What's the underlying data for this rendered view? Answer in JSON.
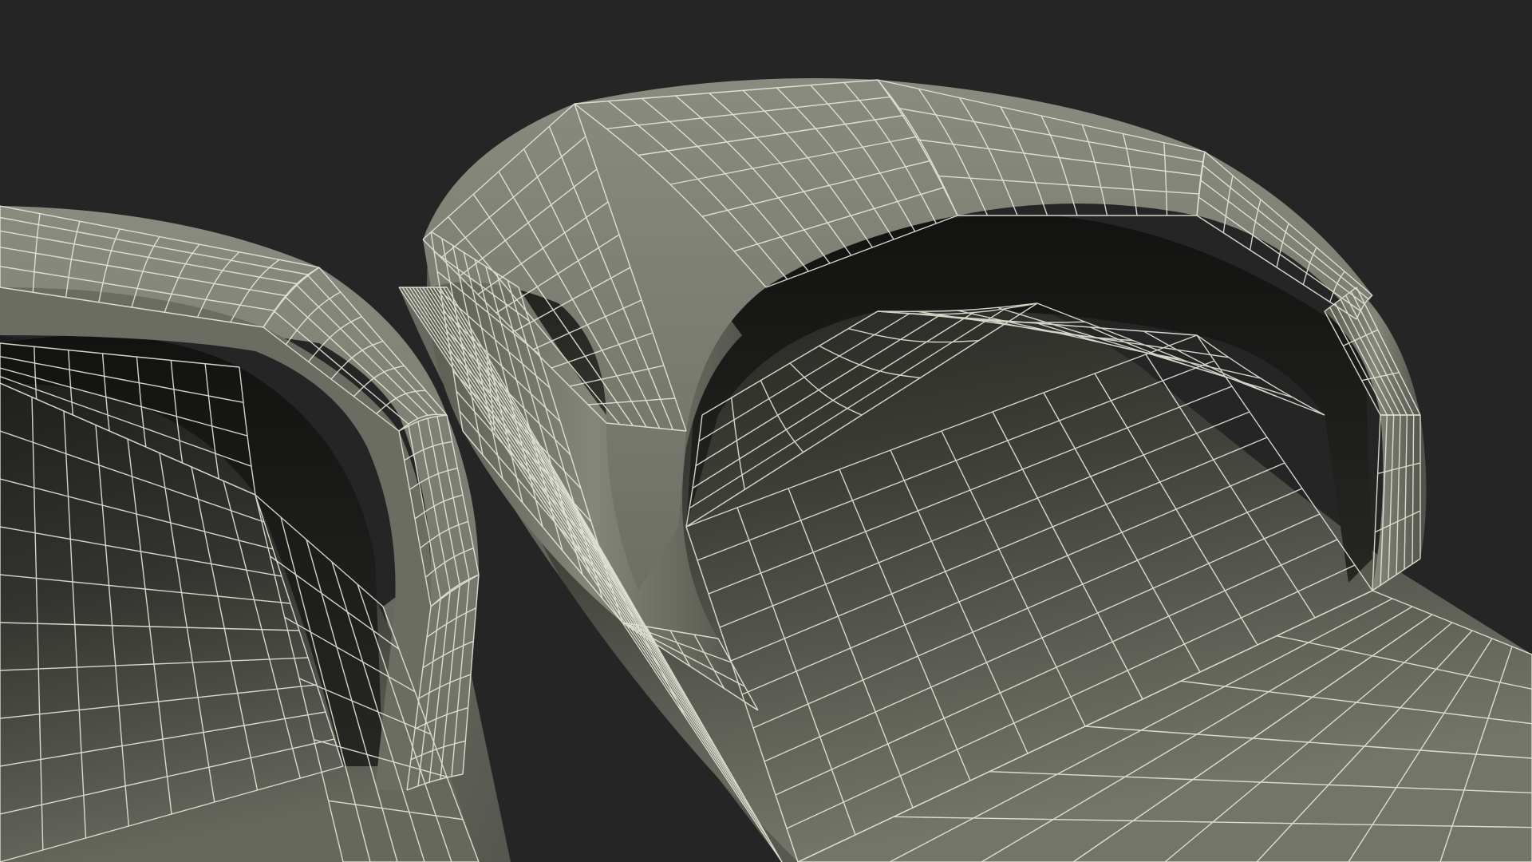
{
  "scene": {
    "background_color": "#252525",
    "subject": "wireframe-slide-sandals-pair",
    "material_color": "#7b7c70",
    "material_shadow_color": "#1a1b18",
    "wire_color": "#e8e8dc"
  }
}
